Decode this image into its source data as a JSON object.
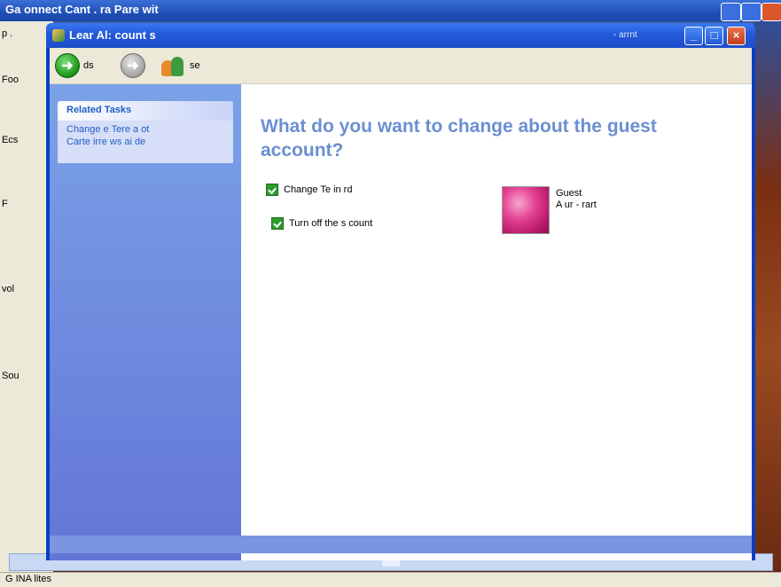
{
  "outer": {
    "title": "Ga onnect Cant . ra Pare wit",
    "status_text": "G INA lites",
    "left_fragments": [
      "p .",
      "Foo",
      "Ecs",
      "F",
      "vol",
      "Sou"
    ]
  },
  "window": {
    "title": "Lear Al: count s",
    "title_right_text": "- arrnt",
    "controls": {
      "minimize": "_",
      "maximize": "□",
      "close": "×"
    }
  },
  "toolbar": {
    "back_label": "ds",
    "forward_label": "",
    "home_label": "se"
  },
  "left_panel": {
    "header": "Related Tasks",
    "links": [
      "Change e Tere a ot",
      "Carte irre ws ai de"
    ]
  },
  "content": {
    "headline": "What do you want to change about the guest account?",
    "tasks": [
      "Change Te in rd",
      "Turn off the s count"
    ],
    "user": {
      "name": "Guest",
      "type": "A  ur - rart"
    }
  },
  "colors": {
    "title_bar": "#2459d8",
    "headline": "#6b8fd1",
    "link": "#215dc6",
    "left_pane": "#6375d6"
  }
}
